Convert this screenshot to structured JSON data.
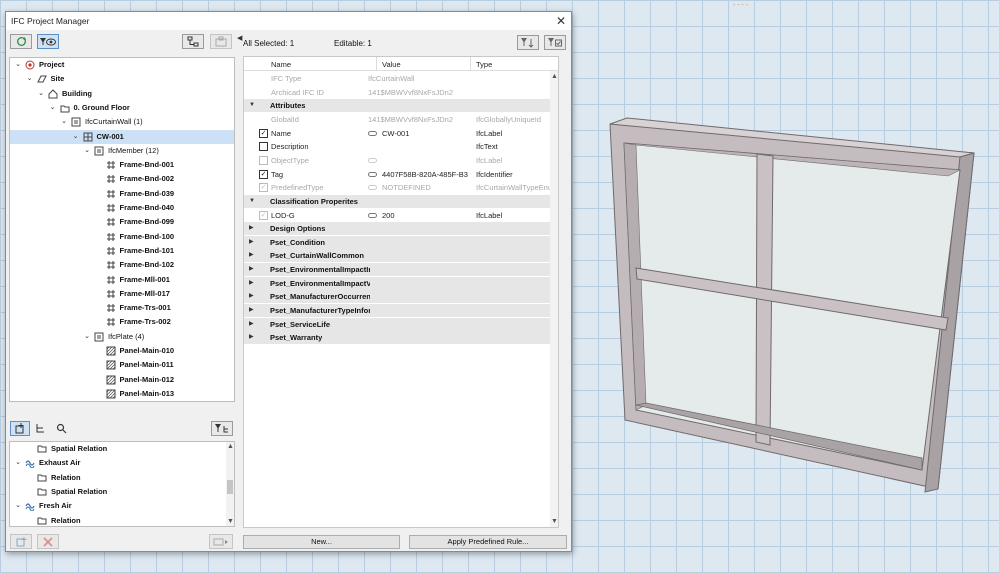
{
  "viewport": {
    "label": "- - - -"
  },
  "dialog": {
    "title": "IFC Project Manager",
    "close_glyph": "✕"
  },
  "toolbar": {
    "refresh_icon": "refresh-icon",
    "filter_view_icon": "eye-filter-icon",
    "hierarchy_icon": "hierarchy-icon",
    "sync_icon": "sync-icon"
  },
  "tree": {
    "items": [
      {
        "label": "Project",
        "level": 0,
        "chevron": "v",
        "icon": "project-icon",
        "bold": true
      },
      {
        "label": "Site",
        "level": 1,
        "chevron": "v",
        "icon": "site-icon",
        "bold": true
      },
      {
        "label": "Building",
        "level": 2,
        "chevron": "v",
        "icon": "building-icon",
        "bold": true
      },
      {
        "label": "0. Ground Floor",
        "level": 3,
        "chevron": "v",
        "icon": "storey-icon",
        "bold": true
      },
      {
        "label": "IfcCurtainWall (1)",
        "level": 4,
        "chevron": "v",
        "icon": "type-folder-icon",
        "bold": false
      },
      {
        "label": "CW-001",
        "level": 5,
        "chevron": "v",
        "icon": "curtain-wall-icon",
        "bold": true,
        "selected": true
      },
      {
        "label": "IfcMember (12)",
        "level": 6,
        "chevron": "v",
        "icon": "type-folder-icon",
        "bold": false
      },
      {
        "label": "Frame-Bnd-001",
        "level": 7,
        "chevron": "",
        "icon": "member-icon",
        "bold": true
      },
      {
        "label": "Frame-Bnd-002",
        "level": 7,
        "chevron": "",
        "icon": "member-icon",
        "bold": true
      },
      {
        "label": "Frame-Bnd-039",
        "level": 7,
        "chevron": "",
        "icon": "member-icon",
        "bold": true
      },
      {
        "label": "Frame-Bnd-040",
        "level": 7,
        "chevron": "",
        "icon": "member-icon",
        "bold": true
      },
      {
        "label": "Frame-Bnd-099",
        "level": 7,
        "chevron": "",
        "icon": "member-icon",
        "bold": true
      },
      {
        "label": "Frame-Bnd-100",
        "level": 7,
        "chevron": "",
        "icon": "member-icon",
        "bold": true
      },
      {
        "label": "Frame-Bnd-101",
        "level": 7,
        "chevron": "",
        "icon": "member-icon",
        "bold": true
      },
      {
        "label": "Frame-Bnd-102",
        "level": 7,
        "chevron": "",
        "icon": "member-icon",
        "bold": true
      },
      {
        "label": "Frame-Mll-001",
        "level": 7,
        "chevron": "",
        "icon": "member-icon",
        "bold": true
      },
      {
        "label": "Frame-Mll-017",
        "level": 7,
        "chevron": "",
        "icon": "member-icon",
        "bold": true
      },
      {
        "label": "Frame-Trs-001",
        "level": 7,
        "chevron": "",
        "icon": "member-icon",
        "bold": true
      },
      {
        "label": "Frame-Trs-002",
        "level": 7,
        "chevron": "",
        "icon": "member-icon",
        "bold": true
      },
      {
        "label": "IfcPlate (4)",
        "level": 6,
        "chevron": "v",
        "icon": "type-folder-icon",
        "bold": false
      },
      {
        "label": "Panel-Main-010",
        "level": 7,
        "chevron": "",
        "icon": "plate-icon",
        "bold": true
      },
      {
        "label": "Panel-Main-011",
        "level": 7,
        "chevron": "",
        "icon": "plate-icon",
        "bold": true
      },
      {
        "label": "Panel-Main-012",
        "level": 7,
        "chevron": "",
        "icon": "plate-icon",
        "bold": true
      },
      {
        "label": "Panel-Main-013",
        "level": 7,
        "chevron": "",
        "icon": "plate-icon",
        "bold": true
      }
    ]
  },
  "lower_tree": {
    "items": [
      {
        "label": "Spatial Relation",
        "level": 1,
        "chevron": "",
        "icon": "folder-icon"
      },
      {
        "label": "Exhaust Air",
        "level": 0,
        "chevron": "v",
        "icon": "system-icon"
      },
      {
        "label": "Relation",
        "level": 1,
        "chevron": "",
        "icon": "folder-icon"
      },
      {
        "label": "Spatial Relation",
        "level": 1,
        "chevron": "",
        "icon": "folder-icon"
      },
      {
        "label": "Fresh Air",
        "level": 0,
        "chevron": "v",
        "icon": "system-icon"
      },
      {
        "label": "Relation",
        "level": 1,
        "chevron": "",
        "icon": "folder-icon"
      }
    ]
  },
  "status": {
    "all_selected": "All Selected: 1",
    "editable": "Editable: 1"
  },
  "props": {
    "headers": {
      "name": "Name",
      "value": "Value",
      "type": "Type"
    },
    "rows": [
      {
        "kind": "prop",
        "dim": true,
        "check": "",
        "name": "IFC Type",
        "value": "IfcCurtainWall",
        "type": "",
        "link": false
      },
      {
        "kind": "prop",
        "dim": true,
        "check": "",
        "name": "Archicad IFC ID",
        "value": "141$MBWVvf8NxFsJDn2",
        "type": "",
        "link": false
      },
      {
        "kind": "group",
        "name": "Attributes",
        "open": true
      },
      {
        "kind": "prop",
        "dim": true,
        "check": "",
        "name": "GlobalId",
        "value": "141$MBWVvf8NxFsJDn2",
        "type": "IfcGloballyUniqueId",
        "link": false
      },
      {
        "kind": "prop",
        "dim": false,
        "check": "checked",
        "name": "Name",
        "value": "CW-001",
        "type": "IfcLabel",
        "link": true
      },
      {
        "kind": "prop",
        "dim": false,
        "check": "empty",
        "name": "Description",
        "value": "",
        "type": "IfcText",
        "link": false
      },
      {
        "kind": "prop",
        "dim": true,
        "check": "empty",
        "name": "ObjectType",
        "value": "",
        "type": "IfcLabel",
        "link": true
      },
      {
        "kind": "prop",
        "dim": false,
        "check": "checked",
        "name": "Tag",
        "value": "4407F58B-820A-485F-B3",
        "type": "IfcIdentifier",
        "link": true
      },
      {
        "kind": "prop",
        "dim": true,
        "check": "checked",
        "name": "PredefinedType",
        "value": "NOTDEFINED",
        "type": "IfcCurtainWallTypeEnum",
        "link": true
      },
      {
        "kind": "group",
        "name": "Classification Properites",
        "open": true
      },
      {
        "kind": "prop",
        "dim": false,
        "check": "checked-dim",
        "name": "LOD-G",
        "value": "200",
        "type": "IfcLabel",
        "link": true
      },
      {
        "kind": "group",
        "name": "Design Options",
        "open": false
      },
      {
        "kind": "group",
        "name": "Pset_Condition",
        "open": false
      },
      {
        "kind": "group",
        "name": "Pset_CurtainWallCommon",
        "open": false
      },
      {
        "kind": "group",
        "name": "Pset_EnvironmentalImpactIn",
        "open": false
      },
      {
        "kind": "group",
        "name": "Pset_EnvironmentalImpactVa",
        "open": false
      },
      {
        "kind": "group",
        "name": "Pset_ManufacturerOccurren",
        "open": false
      },
      {
        "kind": "group",
        "name": "Pset_ManufacturerTypeInfor",
        "open": false
      },
      {
        "kind": "group",
        "name": "Pset_ServiceLife",
        "open": false
      },
      {
        "kind": "group",
        "name": "Pset_Warranty",
        "open": false
      }
    ]
  },
  "buttons": {
    "new": "New...",
    "apply_rule": "Apply Predefined Rule..."
  },
  "glyphs": {
    "chevron_down": "⌄",
    "tri_open": "▼",
    "tri_closed": "▶",
    "check": "✓",
    "scroll_up": "▲",
    "scroll_down": "▼"
  }
}
